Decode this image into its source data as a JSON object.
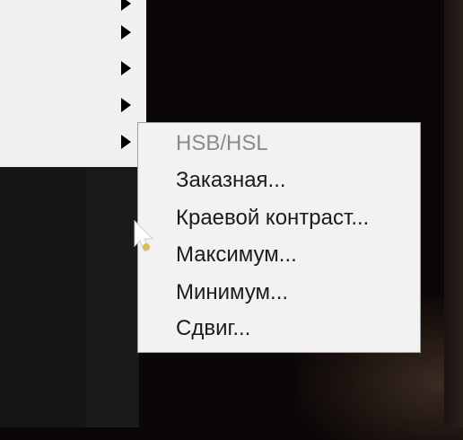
{
  "parent_menu": {
    "items": [
      {
        "has_submenu": true
      },
      {
        "has_submenu": true
      },
      {
        "has_submenu": true
      },
      {
        "has_submenu": true
      },
      {
        "has_submenu": true,
        "active": true
      }
    ]
  },
  "submenu": {
    "items": [
      {
        "label": "HSB/HSL",
        "enabled": false
      },
      {
        "label": "Заказная...",
        "enabled": true
      },
      {
        "label": "Краевой контраст...",
        "enabled": true
      },
      {
        "label": "Максимум...",
        "enabled": true
      },
      {
        "label": "Минимум...",
        "enabled": true
      },
      {
        "label": "Сдвиг...",
        "enabled": true
      }
    ]
  },
  "icons": {
    "submenu_arrow": "chevron-right-icon",
    "cursor": "mouse-pointer-icon"
  },
  "colors": {
    "menu_background": "#f2f2f2",
    "menu_text": "#1b1b1b",
    "disabled_text": "#8a8a8a",
    "menu_border": "#a0a0a0",
    "desktop_background": "#0b0707"
  }
}
